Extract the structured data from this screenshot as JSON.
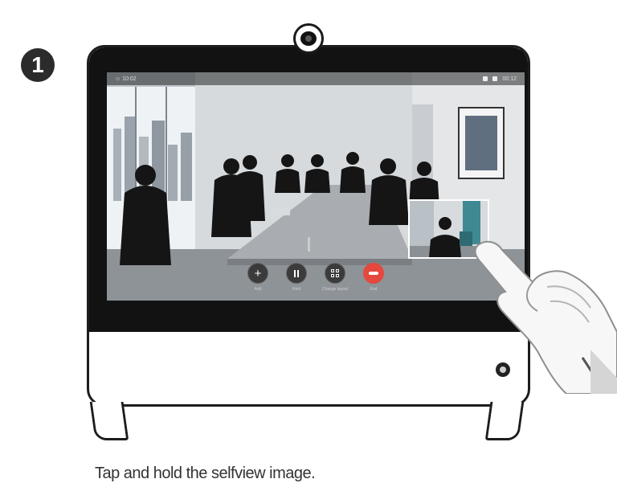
{
  "step": {
    "number": "1"
  },
  "screen": {
    "status_left": "☺ 10:02",
    "status_right": "00:12"
  },
  "controls": [
    {
      "id": "add",
      "icon": "plus-icon",
      "label": "Add"
    },
    {
      "id": "hold",
      "icon": "pause-icon",
      "label": "Hold"
    },
    {
      "id": "layout",
      "icon": "layout-icon",
      "label": "Change layout"
    },
    {
      "id": "end",
      "icon": "end-call-icon",
      "label": "End"
    }
  ],
  "colors": {
    "end_call": "#e5483d",
    "bezel": "#121212",
    "frame": "#1d1d1d"
  },
  "caption": "Tap and hold the selfview image."
}
